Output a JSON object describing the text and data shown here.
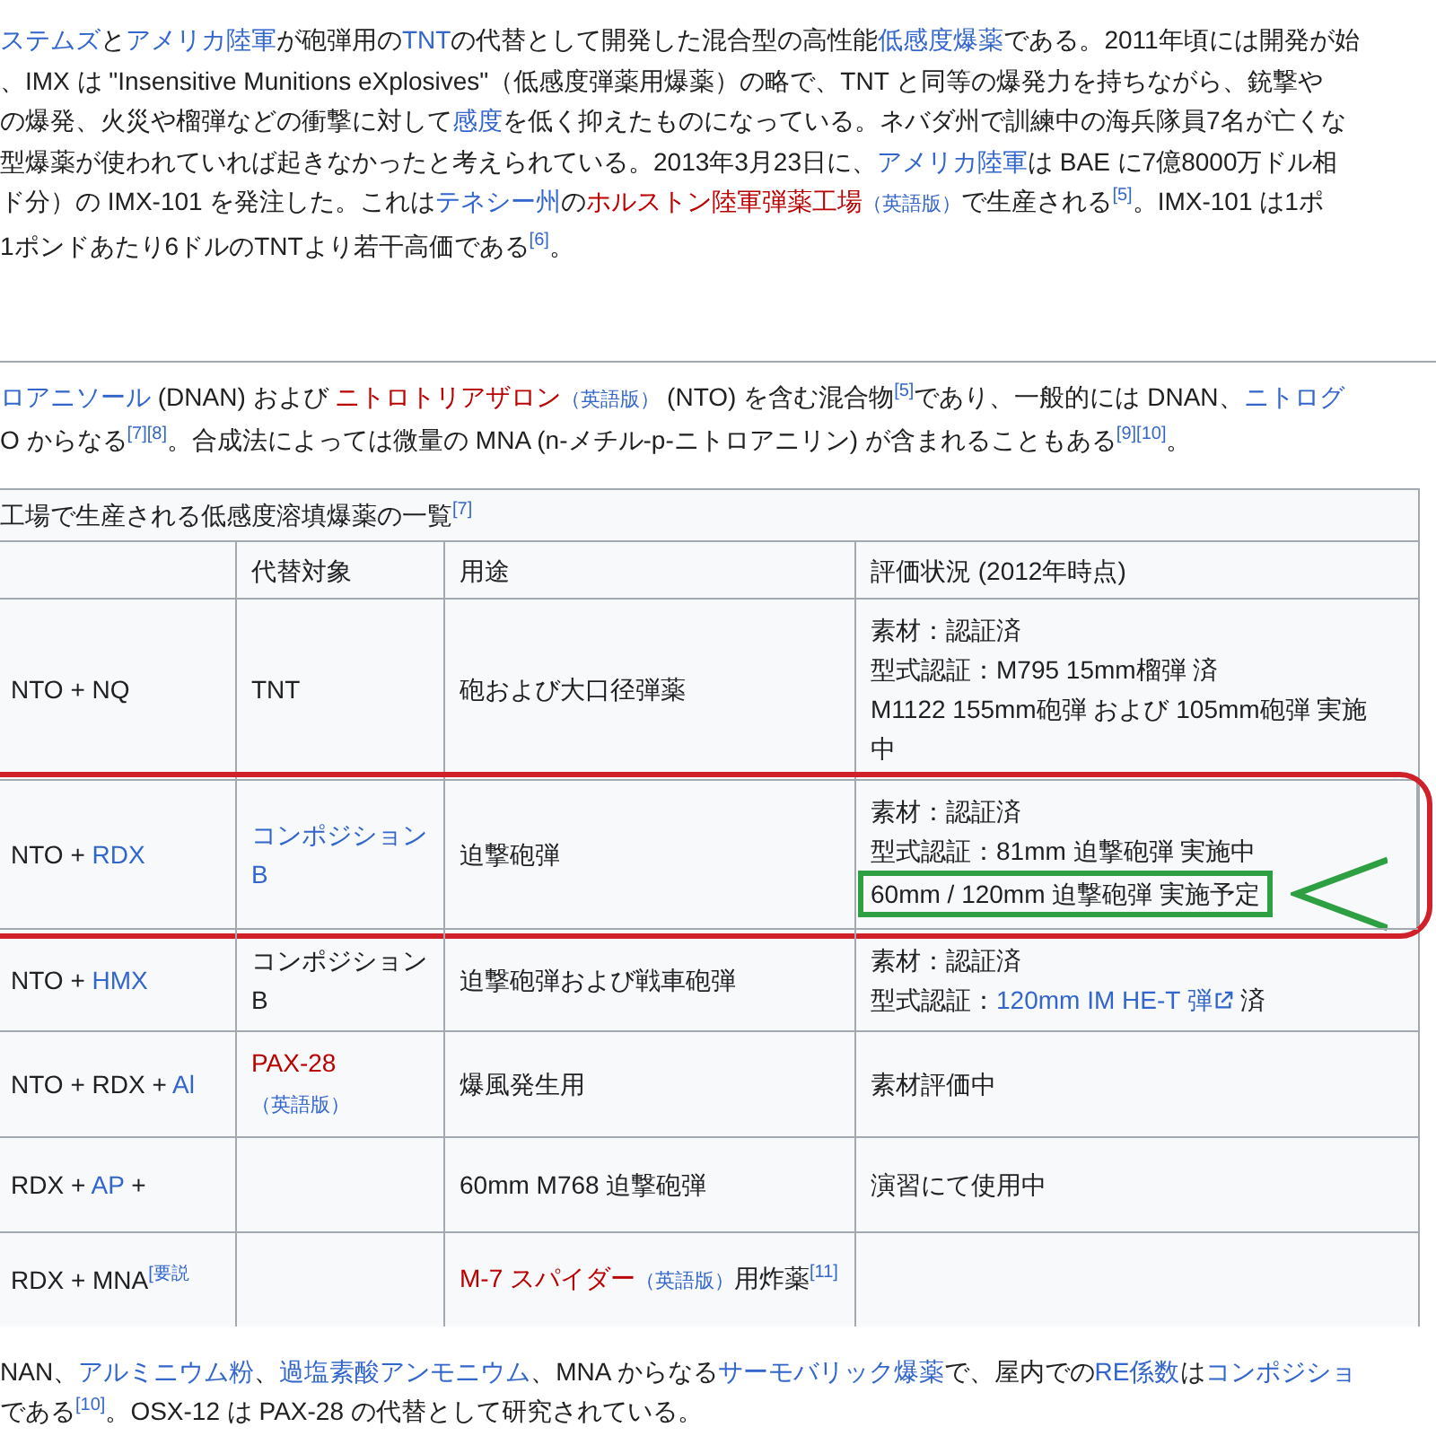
{
  "intro_paragraph": [
    [
      {
        "kind": "link",
        "text": "ステムズ"
      },
      {
        "kind": "text",
        "text": "と"
      },
      {
        "kind": "link",
        "text": "アメリカ陸軍"
      },
      {
        "kind": "text",
        "text": "が砲弾用の"
      },
      {
        "kind": "link",
        "text": "TNT"
      },
      {
        "kind": "text",
        "text": "の代替として開発した混合型の高性能"
      },
      {
        "kind": "link",
        "text": "低感度爆薬"
      },
      {
        "kind": "text",
        "text": "である。2011年頃には開発が始"
      }
    ],
    [
      {
        "kind": "text",
        "text": "、IMX は \"Insensitive Munitions eXplosives\"（低感度弾薬用爆薬）の略で、TNT と同等の爆発力を持ちながら、銃撃や"
      }
    ],
    [
      {
        "kind": "text",
        "text": "の爆発、火災や榴弾などの衝撃に対して"
      },
      {
        "kind": "link",
        "text": "感度"
      },
      {
        "kind": "text",
        "text": "を低く抑えたものになっている。ネバダ州で訓練中の海兵隊員7名が亡くな"
      }
    ],
    [
      {
        "kind": "text",
        "text": "型爆薬が使われていれば起きなかったと考えられている。2013年3月23日に、"
      },
      {
        "kind": "link",
        "text": "アメリカ陸軍"
      },
      {
        "kind": "text",
        "text": "は BAE に7億8000万ドル相"
      }
    ],
    [
      {
        "kind": "text",
        "text": "ド分）の IMX-101 を発注した。これは"
      },
      {
        "kind": "link",
        "text": "テネシー州"
      },
      {
        "kind": "text",
        "text": "の"
      },
      {
        "kind": "redlink",
        "text": "ホルストン陸軍弾薬工場"
      },
      {
        "kind": "lang",
        "text": "（英語版）"
      },
      {
        "kind": "text",
        "text": "で生産される"
      },
      {
        "kind": "ref",
        "text": "[5]"
      },
      {
        "kind": "text",
        "text": "。IMX-101 は1ポ"
      }
    ],
    [
      {
        "kind": "text",
        "text": "1ポンドあたり6ドルのTNTより若干高価である"
      },
      {
        "kind": "ref",
        "text": "[6]"
      },
      {
        "kind": "text",
        "text": "。"
      }
    ]
  ],
  "section_paragraph": [
    [
      {
        "kind": "link",
        "text": "ロアニソール"
      },
      {
        "kind": "text",
        "text": " (DNAN) および "
      },
      {
        "kind": "redlink",
        "text": "ニトロトリアザロン"
      },
      {
        "kind": "lang",
        "text": "（英語版）"
      },
      {
        "kind": "text",
        "text": " (NTO) を含む混合物"
      },
      {
        "kind": "ref",
        "text": "[5]"
      },
      {
        "kind": "text",
        "text": "であり、一般的には DNAN、"
      },
      {
        "kind": "link",
        "text": "ニトログ"
      }
    ],
    [
      {
        "kind": "text",
        "text": "O からなる"
      },
      {
        "kind": "ref",
        "text": "[7]"
      },
      {
        "kind": "ref",
        "text": "[8]"
      },
      {
        "kind": "text",
        "text": "。合成法によっては微量の MNA (n-メチル-p-ニトロアニリン) が含まれることもある"
      },
      {
        "kind": "ref",
        "text": "[9]"
      },
      {
        "kind": "ref",
        "text": "[10]"
      },
      {
        "kind": "text",
        "text": "。"
      }
    ]
  ],
  "table": {
    "caption": [
      {
        "kind": "text",
        "text": "工場で生産される低感度溶填爆薬の一覧"
      },
      {
        "kind": "ref",
        "text": "[7]"
      }
    ],
    "headings": [
      "代替対象",
      "用途",
      "評価状況 (2012年時点)"
    ],
    "rows": [
      {
        "circled": false,
        "cells": [
          [
            [
              {
                "kind": "text",
                "text": "NTO + NQ"
              }
            ]
          ],
          [
            [
              {
                "kind": "text",
                "text": "TNT"
              }
            ]
          ],
          [
            [
              {
                "kind": "text",
                "text": "砲および大口径弾薬"
              }
            ]
          ],
          [
            [
              {
                "kind": "text",
                "text": "素材：認証済"
              }
            ],
            [
              {
                "kind": "text",
                "text": "型式認証：M795 15mm榴弾 済"
              }
            ],
            [
              {
                "kind": "text",
                "text": "M1122 155mm砲弾 および 105mm砲弾 実施中"
              }
            ]
          ]
        ]
      },
      {
        "circled": true,
        "cells": [
          [
            [
              {
                "kind": "text",
                "text": "NTO + "
              },
              {
                "kind": "link",
                "text": "RDX"
              }
            ]
          ],
          [
            [
              {
                "kind": "link",
                "text": "コンポジション B"
              }
            ]
          ],
          [
            [
              {
                "kind": "text",
                "text": "迫撃砲弾"
              }
            ]
          ],
          [
            [
              {
                "kind": "text",
                "text": "素材：認証済"
              }
            ],
            [
              {
                "kind": "text",
                "text": "型式認証：81mm 迫撃砲弾 実施中"
              }
            ],
            [
              {
                "kind": "boxed",
                "text": "60mm / 120mm 迫撃砲弾 実施予定"
              }
            ]
          ]
        ]
      },
      {
        "circled": false,
        "cells": [
          [
            [
              {
                "kind": "text",
                "text": "NTO + "
              },
              {
                "kind": "link",
                "text": "HMX"
              }
            ]
          ],
          [
            [
              {
                "kind": "text",
                "text": "コンポジション B"
              }
            ]
          ],
          [
            [
              {
                "kind": "text",
                "text": "迫撃砲弾および戦車砲弾"
              }
            ]
          ],
          [
            [
              {
                "kind": "text",
                "text": "素材：認証済"
              }
            ],
            [
              {
                "kind": "text",
                "text": "型式認証："
              },
              {
                "kind": "extlink",
                "text": "120mm IM HE-T 弾"
              },
              {
                "kind": "text",
                "text": " 済"
              }
            ]
          ]
        ]
      },
      {
        "circled": false,
        "cells": [
          [
            [
              {
                "kind": "text",
                "text": "NTO + RDX + "
              },
              {
                "kind": "link",
                "text": "Al"
              }
            ]
          ],
          [
            [
              {
                "kind": "redlink",
                "text": "PAX-28"
              },
              {
                "kind": "lang",
                "text": "（英語版）"
              }
            ]
          ],
          [
            [
              {
                "kind": "text",
                "text": "爆風発生用"
              }
            ]
          ],
          [
            [
              {
                "kind": "text",
                "text": "素材評価中"
              }
            ]
          ]
        ]
      },
      {
        "circled": false,
        "cells": [
          [
            [
              {
                "kind": "text",
                "text": "RDX + "
              },
              {
                "kind": "link",
                "text": "AP"
              },
              {
                "kind": "text",
                "text": " +"
              }
            ]
          ],
          null,
          [
            [
              {
                "kind": "text",
                "text": "60mm M768 迫撃砲弾"
              }
            ]
          ],
          [
            [
              {
                "kind": "text",
                "text": "演習にて使用中"
              }
            ]
          ]
        ]
      },
      {
        "circled": false,
        "cells": [
          [
            [
              {
                "kind": "text",
                "text": "RDX + MNA"
              },
              {
                "kind": "ref",
                "text": "[要説"
              }
            ]
          ],
          null,
          [
            [
              {
                "kind": "redlink",
                "text": "M-7 スパイダー"
              },
              {
                "kind": "lang",
                "text": "（英語版）"
              },
              {
                "kind": "text",
                "text": "用炸薬"
              },
              {
                "kind": "ref",
                "text": "[11]"
              }
            ]
          ],
          null
        ]
      }
    ]
  },
  "closing_paragraph": [
    [
      {
        "kind": "text",
        "text": "NAN、"
      },
      {
        "kind": "link",
        "text": "アルミニウム粉"
      },
      {
        "kind": "text",
        "text": "、"
      },
      {
        "kind": "link",
        "text": "過塩素酸アンモニウム"
      },
      {
        "kind": "text",
        "text": "、MNA からなる"
      },
      {
        "kind": "link",
        "text": "サーモバリック爆薬"
      },
      {
        "kind": "text",
        "text": "で、屋内での"
      },
      {
        "kind": "link",
        "text": "RE係数"
      },
      {
        "kind": "text",
        "text": "は"
      },
      {
        "kind": "link",
        "text": "コンポジショ"
      }
    ],
    [
      {
        "kind": "text",
        "text": "である"
      },
      {
        "kind": "ref",
        "text": "[10]"
      },
      {
        "kind": "text",
        "text": "。OSX-12 は PAX-28 の代替として研究されている。"
      }
    ]
  ]
}
